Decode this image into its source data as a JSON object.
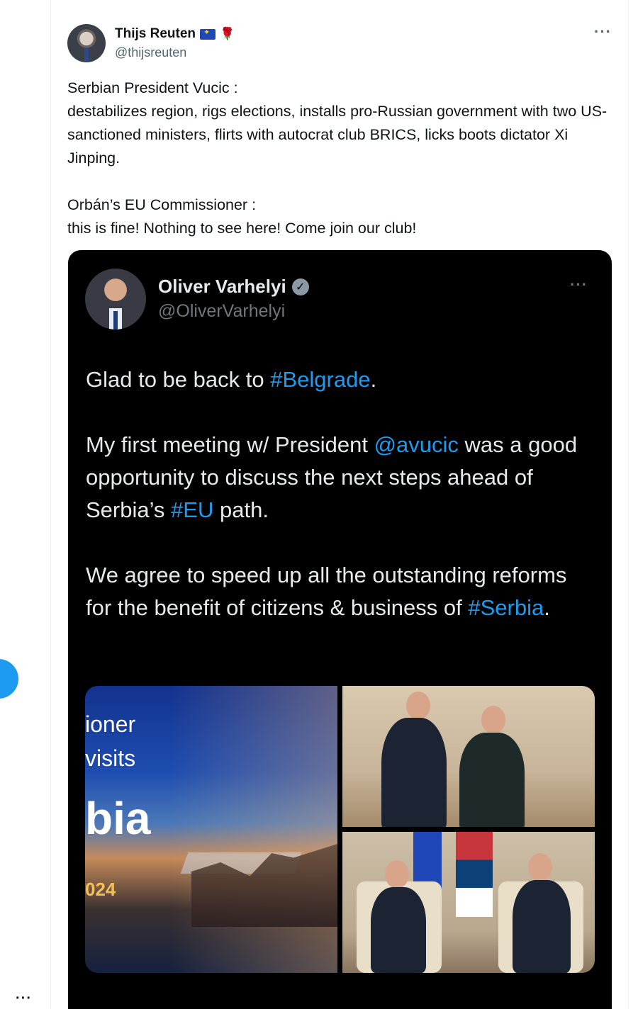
{
  "author": {
    "name": "Thijs Reuten",
    "handle": "@thijsreuten",
    "badges": [
      "eu-flag-icon",
      "rose-icon"
    ]
  },
  "tweet": {
    "line1": "Serbian President Vucic :",
    "line2": "destabilizes region, rigs elections, installs pro-Russian government with two US-sanctioned ministers, flirts with autocrat club BRICS, licks boots dictator Xi Jinping.",
    "line3": "Orbán’s EU Commissioner :",
    "line4": "this is fine! Nothing to see here! Come join our club!"
  },
  "more_label": "···",
  "quoted": {
    "name": "Oliver Varhelyi",
    "handle": "@OliverVarhelyi",
    "verified_mark": "✓",
    "more_label": "···",
    "p1_before": "Glad to be back to ",
    "p1_link": "#Belgrade",
    "p1_after": ".",
    "p2_before": "My first meeting w/ President ",
    "p2_link1": "@avucic",
    "p2_mid": " was a good opportunity to discuss the next steps ahead of Serbia’s ",
    "p2_link2": "#EU",
    "p2_after": " path.",
    "p3_before": "We agree to speed up all the outstanding reforms for the benefit of citizens & business of ",
    "p3_link": "#Serbia",
    "p3_after": "."
  },
  "media": {
    "left_line1": "ioner",
    "left_line2": "visits",
    "left_line3": "bia",
    "left_line4": "024"
  },
  "rail": {
    "more_label": "···"
  },
  "colors": {
    "link": "#1d9bf0",
    "card_bg": "#000000",
    "secondary_text": "#536471"
  }
}
